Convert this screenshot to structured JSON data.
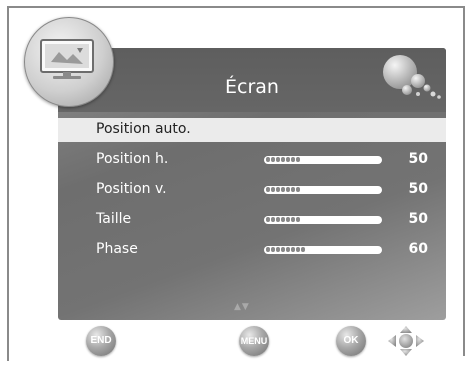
{
  "menu": {
    "title": "Écran",
    "items": [
      {
        "label": "Position auto.",
        "selected": true
      },
      {
        "label": "Position h.",
        "value": "50",
        "level": 0.5
      },
      {
        "label": "Position v.",
        "value": "50",
        "level": 0.5
      },
      {
        "label": "Taille",
        "value": "50",
        "level": 0.5
      },
      {
        "label": "Phase",
        "value": "60",
        "level": 0.6
      }
    ]
  },
  "buttons": {
    "end_label": "END",
    "menu_label": "MENU",
    "ok_label": "OK"
  },
  "icons": {
    "badge": "monitor-icon",
    "decor": "bubbles-icon",
    "scroll": "scroll-arrows-icon",
    "dpad": "dpad-icon"
  },
  "colors": {
    "selected_row": "#ebebeb",
    "panel": "#777777",
    "title_band": "#626262"
  }
}
